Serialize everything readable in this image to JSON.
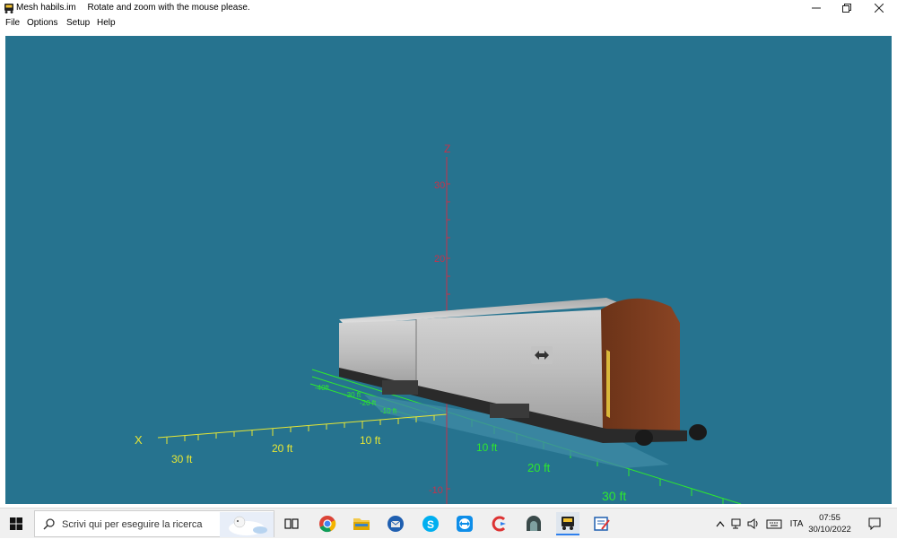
{
  "window": {
    "file_name": "Mesh habils.im",
    "hint": "Rotate and zoom with the mouse please."
  },
  "menu": {
    "items": [
      "File",
      "Options",
      "Setup",
      "Help"
    ]
  },
  "scene": {
    "background": "#26738f",
    "z_axis": {
      "label": "Z",
      "ticks": [
        "30",
        "20",
        "-10"
      ],
      "color": "#c8314a"
    },
    "x_axis": {
      "label": "X",
      "ticks": [
        "30 ft",
        "20 ft",
        "10 ft"
      ],
      "color": "#e6e635"
    },
    "y_axis": {
      "ticks": [
        "10 ft",
        "20 ft",
        "30 ft"
      ],
      "color": "#2ee82e"
    },
    "green_labels": [
      "-40ft",
      "-30 ft",
      "-20 ft",
      "-10 ft"
    ]
  },
  "taskbar": {
    "search_placeholder": "Scrivi qui per eseguire la ricerca",
    "language": "ITA",
    "time": "07:55",
    "date": "30/10/2022"
  }
}
